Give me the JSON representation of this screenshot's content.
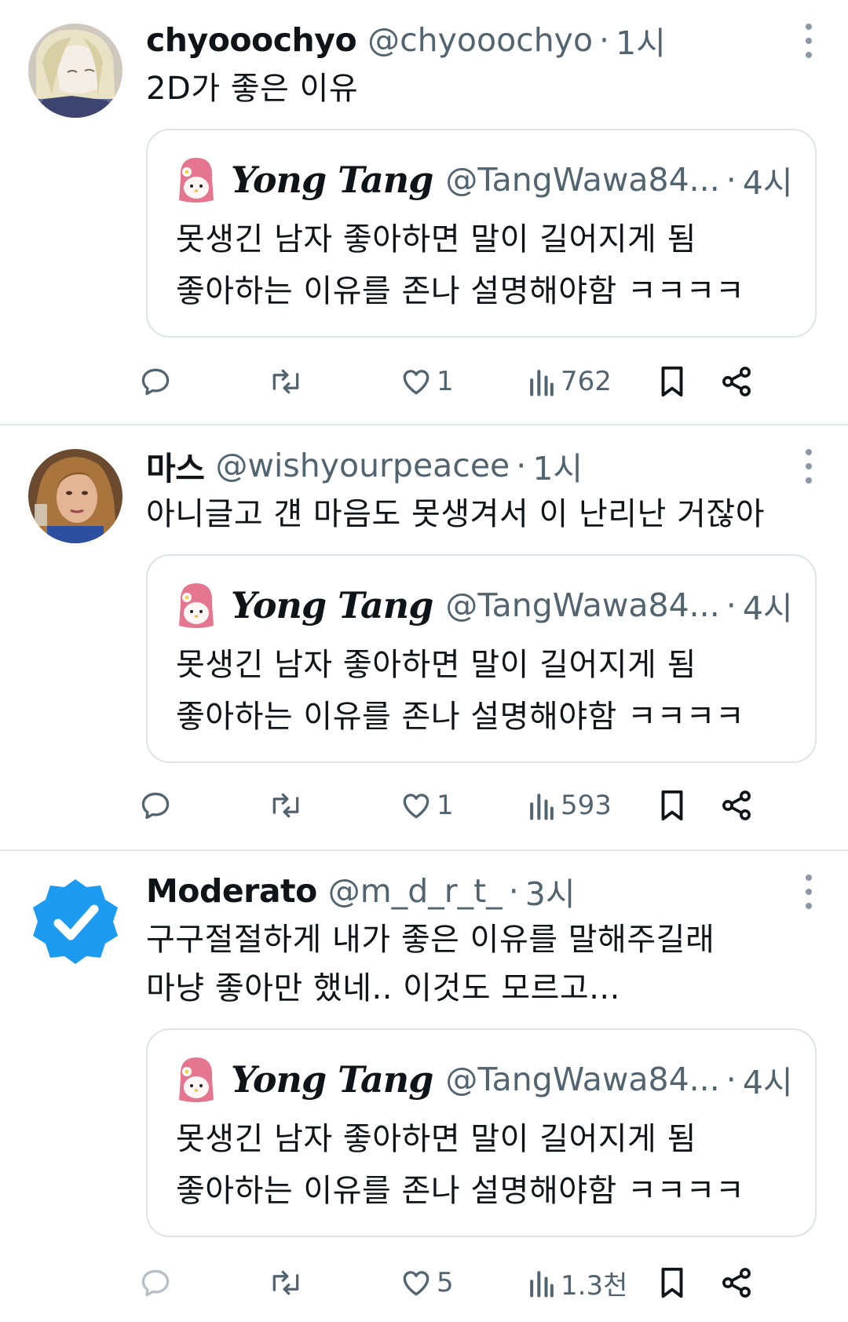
{
  "tweets": [
    {
      "name": "chyooochyo",
      "handle": "@chyooochyo",
      "dot": "·",
      "time": "1시",
      "text": "2D가 좋은 이유",
      "avatar": "anime-avatar",
      "quote": {
        "name": "Yong Tang",
        "handle": "@TangWawa84...",
        "dot": "·",
        "time": "4시",
        "text_line1": "못생긴 남자 좋아하면 말이 길어지게 됨",
        "text_line2": "좋아하는 이유를 존나 설명해야함 ㅋㅋㅋㅋ"
      },
      "likes": "1",
      "views": "762"
    },
    {
      "name": "마스",
      "handle": "@wishyourpeacee",
      "dot": "·",
      "time": "1시",
      "text": "아니글고 걘 마음도 못생겨서 이 난리난 거잖아",
      "avatar": "photo-avatar",
      "quote": {
        "name": "Yong Tang",
        "handle": "@TangWawa84...",
        "dot": "·",
        "time": "4시",
        "text_line1": "못생긴 남자 좋아하면 말이 길어지게 됨",
        "text_line2": "좋아하는 이유를 존나 설명해야함 ㅋㅋㅋㅋ"
      },
      "likes": "1",
      "views": "593"
    },
    {
      "name": "Moderato",
      "handle": "@m_d_r_t_",
      "dot": "·",
      "time": "3시",
      "text_line1": "구구절절하게 내가 좋은 이유를 말해주길래",
      "text_line2": "마냥 좋아만 했네.. 이것도 모르고...",
      "avatar": "verified-badge-avatar",
      "quote": {
        "name": "Yong Tang",
        "handle": "@TangWawa84...",
        "dot": "·",
        "time": "4시",
        "text_line1": "못생긴 남자 좋아하면 말이 길어지게 됨",
        "text_line2": "좋아하는 이유를 존나 설명해야함 ㅋㅋㅋㅋ"
      },
      "likes": "5",
      "views": "1.3천"
    }
  ],
  "colors": {
    "text": "#0f1419",
    "secondary": "#536471",
    "border": "#e3e6e9",
    "verified": "#1d9bf0"
  },
  "icons": [
    "reply-icon",
    "retweet-icon",
    "like-icon",
    "views-icon",
    "bookmark-icon",
    "share-icon",
    "more-icon"
  ]
}
